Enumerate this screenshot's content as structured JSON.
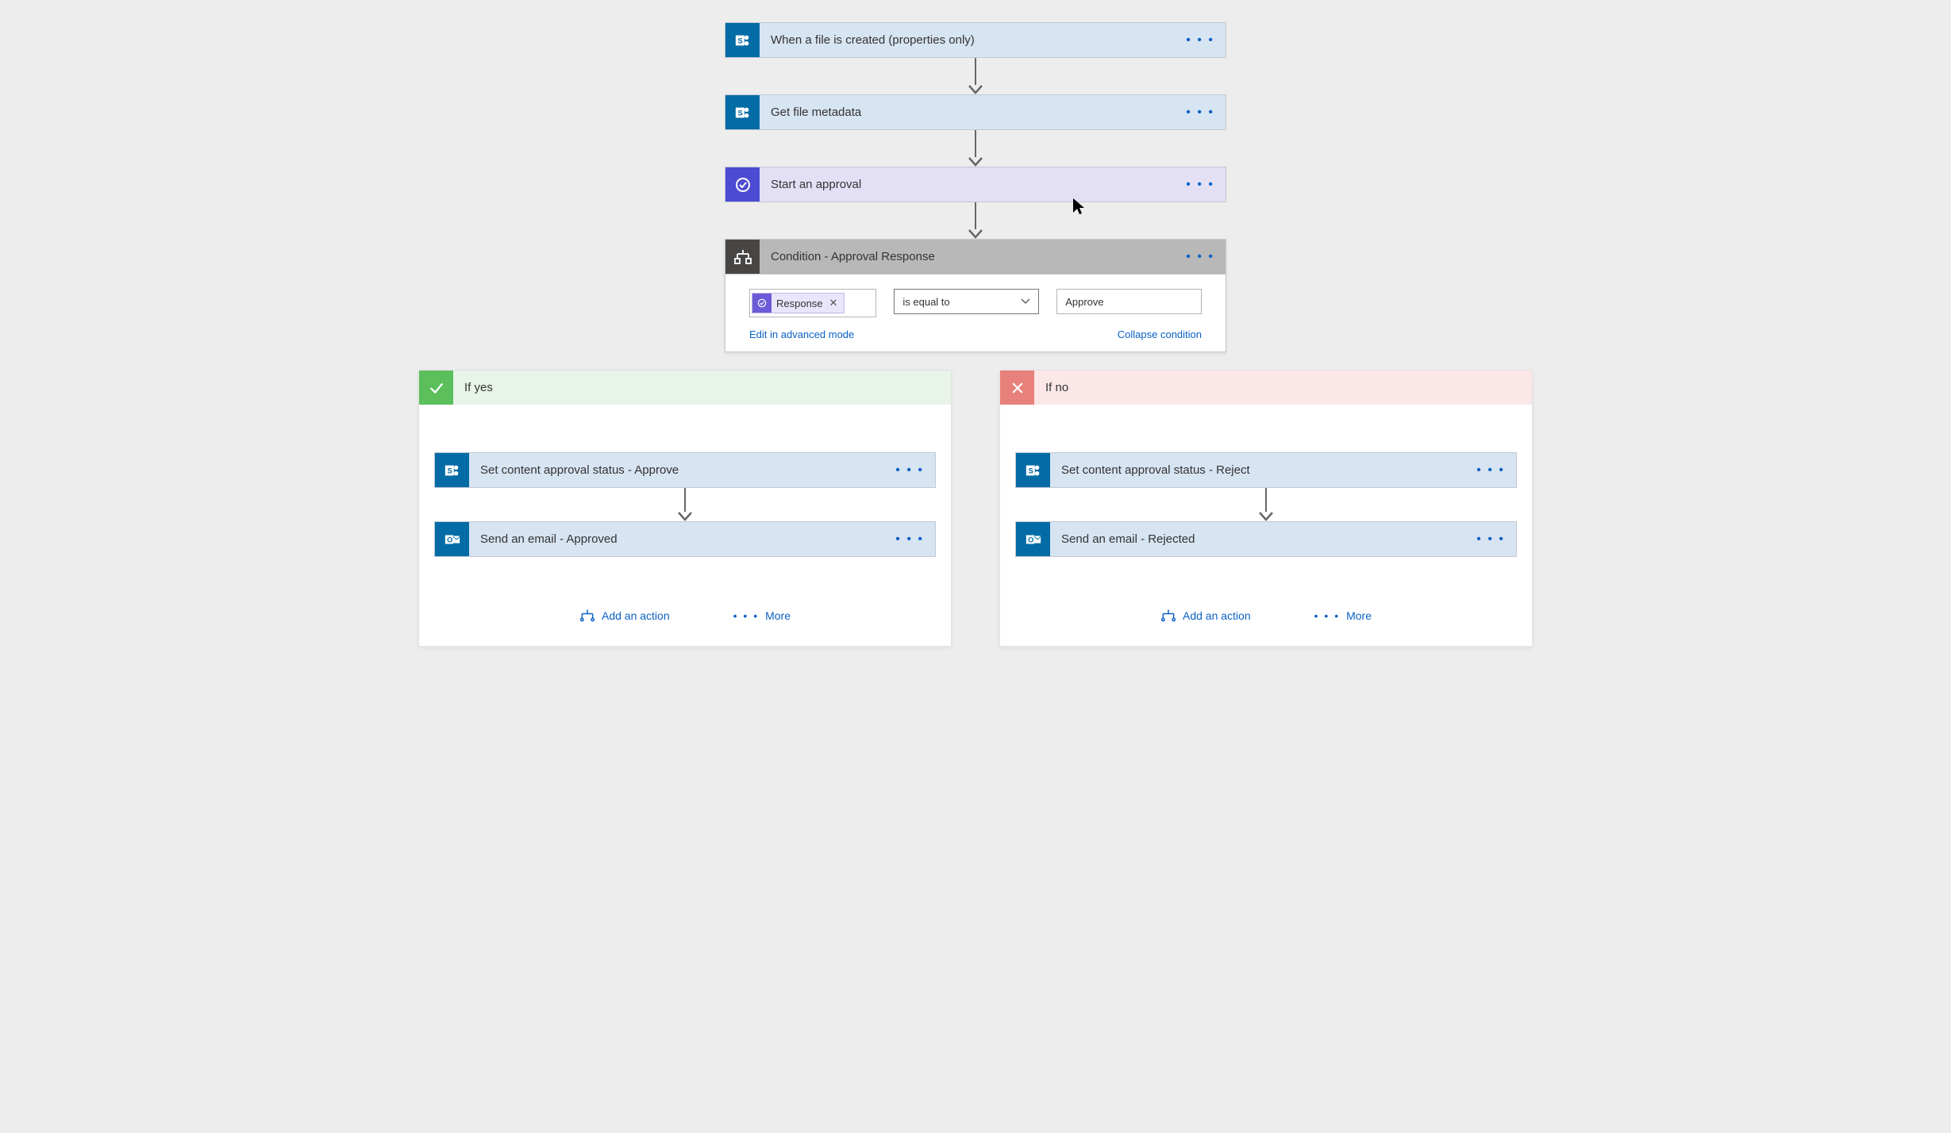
{
  "flow": {
    "step1": {
      "title": "When a file is created (properties only)"
    },
    "step2": {
      "title": "Get file metadata"
    },
    "step3": {
      "title": "Start an approval"
    },
    "condition": {
      "title": "Condition - Approval Response",
      "token": "Response",
      "operator": "is equal to",
      "value": "Approve",
      "edit_link": "Edit in advanced mode",
      "collapse_link": "Collapse condition"
    },
    "yes": {
      "title": "If yes",
      "a1": "Set content approval status - Approve",
      "a2": "Send an email - Approved"
    },
    "no": {
      "title": "If no",
      "a1": "Set content approval status - Reject",
      "a2": "Send an email - Rejected"
    },
    "actions": {
      "add": "Add an action",
      "more": "More"
    }
  }
}
